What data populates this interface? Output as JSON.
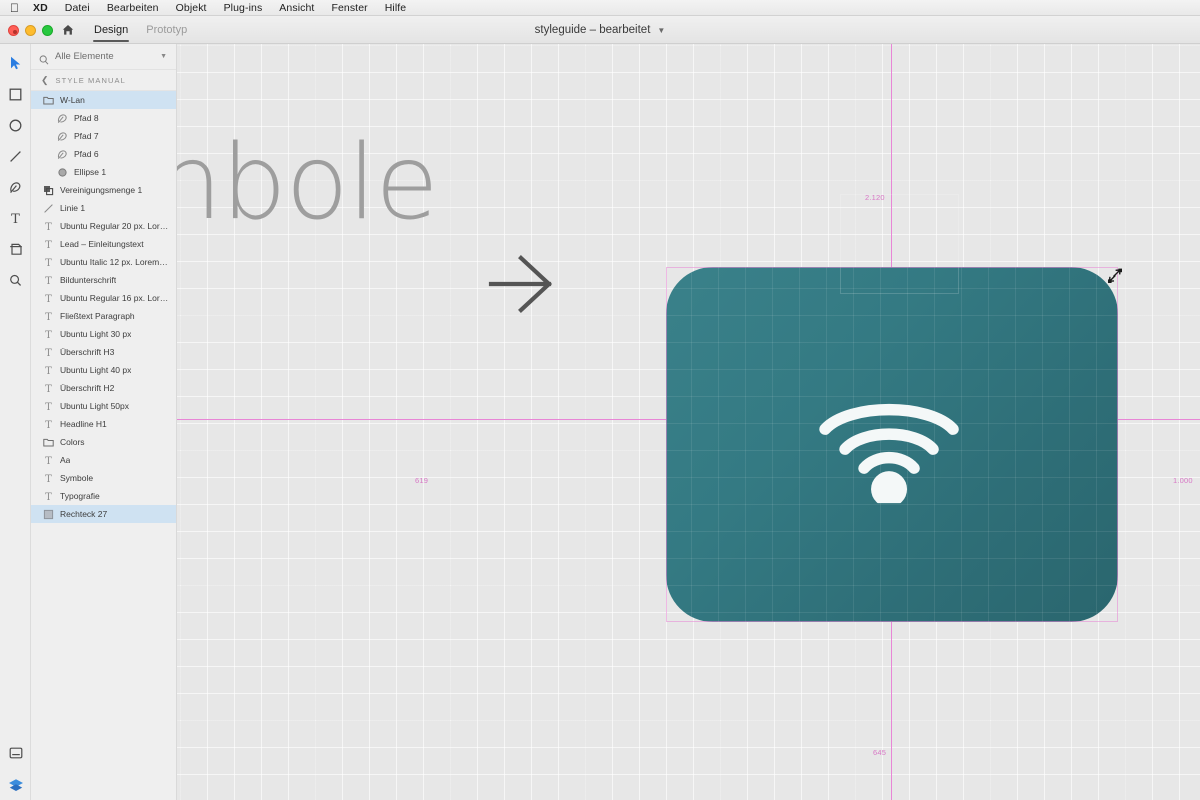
{
  "menubar": {
    "apple_icon": "apple-logo",
    "items": [
      {
        "label": "XD",
        "bold": true
      },
      {
        "label": "Datei",
        "bold": false
      },
      {
        "label": "Bearbeiten",
        "bold": false
      },
      {
        "label": "Objekt",
        "bold": false
      },
      {
        "label": "Plug-ins",
        "bold": false
      },
      {
        "label": "Ansicht",
        "bold": false
      },
      {
        "label": "Fenster",
        "bold": false
      },
      {
        "label": "Hilfe",
        "bold": false
      }
    ]
  },
  "titlebar": {
    "home_icon": "home-icon",
    "tabs": [
      {
        "label": "Design",
        "active": true
      },
      {
        "label": "Prototyp",
        "active": false
      }
    ],
    "document_title": "styleguide – bearbeitet",
    "title_chevron": "chevron-down-icon"
  },
  "toolrail": {
    "tools": [
      {
        "name": "select-tool",
        "icon": "cursor-arrow-icon",
        "active": true
      },
      {
        "name": "rectangle-tool",
        "icon": "square-icon",
        "active": false
      },
      {
        "name": "ellipse-tool",
        "icon": "circle-icon",
        "active": false
      },
      {
        "name": "line-tool",
        "icon": "line-icon",
        "active": false
      },
      {
        "name": "pen-tool",
        "icon": "pen-icon",
        "active": false
      },
      {
        "name": "text-tool",
        "icon": "text-T-icon",
        "active": false
      },
      {
        "name": "artboard-tool",
        "icon": "artboard-icon",
        "active": false
      },
      {
        "name": "zoom-tool",
        "icon": "magnifier-icon",
        "active": false
      }
    ],
    "bottom": [
      {
        "name": "panel-toggle",
        "icon": "panel-icon"
      },
      {
        "name": "creative-cloud-libraries",
        "icon": "layers-stack-icon"
      }
    ],
    "accent_color": "#2a7de1"
  },
  "sidebar": {
    "search": {
      "icon": "search-icon",
      "value": "Alle Elemente",
      "placeholder": "Alle Elemente",
      "chevron": "chevron-down-icon"
    },
    "group_header": {
      "back_icon": "chevron-left-icon",
      "title": "STYLE MANUAL"
    },
    "layers": [
      {
        "label": "W-Lan",
        "icon": "folder-icon",
        "indent": false,
        "selected": true
      },
      {
        "label": "Pfad 8",
        "icon": "path-icon",
        "indent": true,
        "selected": false
      },
      {
        "label": "Pfad 7",
        "icon": "path-icon",
        "indent": true,
        "selected": false
      },
      {
        "label": "Pfad 6",
        "icon": "path-icon",
        "indent": true,
        "selected": false
      },
      {
        "label": "Ellipse 1",
        "icon": "ellipse-icon",
        "indent": true,
        "selected": false
      },
      {
        "label": "Vereinigungsmenge 1",
        "icon": "boolean-union-icon",
        "indent": false,
        "selected": false
      },
      {
        "label": "Linie 1",
        "icon": "line-icon",
        "indent": false,
        "selected": false
      },
      {
        "label": "Ubuntu Regular 20 px. Lor…",
        "icon": "text-icon",
        "indent": false,
        "selected": false
      },
      {
        "label": "Lead – Einleitungstext",
        "icon": "text-icon",
        "indent": false,
        "selected": false
      },
      {
        "label": "Ubuntu Italic 12 px. Lorem…",
        "icon": "text-icon",
        "indent": false,
        "selected": false
      },
      {
        "label": "Bildunterschrift",
        "icon": "text-icon",
        "indent": false,
        "selected": false
      },
      {
        "label": "Ubuntu Regular 16 px. Lor…",
        "icon": "text-icon",
        "indent": false,
        "selected": false
      },
      {
        "label": "Fließtext Paragraph",
        "icon": "text-icon",
        "indent": false,
        "selected": false
      },
      {
        "label": "Ubuntu Light 30 px",
        "icon": "text-icon",
        "indent": false,
        "selected": false
      },
      {
        "label": "Überschrift H3",
        "icon": "text-icon",
        "indent": false,
        "selected": false
      },
      {
        "label": "Ubuntu Light 40 px",
        "icon": "text-icon",
        "indent": false,
        "selected": false
      },
      {
        "label": "Überschrift H2",
        "icon": "text-icon",
        "indent": false,
        "selected": false
      },
      {
        "label": "Ubuntu Light 50px",
        "icon": "text-icon",
        "indent": false,
        "selected": false
      },
      {
        "label": "Headline H1",
        "icon": "text-icon",
        "indent": false,
        "selected": false
      },
      {
        "label": "Colors",
        "icon": "folder-icon",
        "indent": false,
        "selected": false
      },
      {
        "label": "Aa",
        "icon": "text-icon",
        "indent": false,
        "selected": false
      },
      {
        "label": "Symbole",
        "icon": "text-icon",
        "indent": false,
        "selected": false
      },
      {
        "label": "Typografie",
        "icon": "text-icon",
        "indent": false,
        "selected": false
      },
      {
        "label": "Rechteck 27",
        "icon": "rectangle-icon",
        "indent": false,
        "selected": true
      }
    ],
    "selection_color": "#cfe2f2"
  },
  "canvas": {
    "background_text": "nbole",
    "guide_labels": [
      {
        "name": "guide-label-2120",
        "value": "2.120"
      },
      {
        "name": "guide-label-619",
        "value": "619"
      },
      {
        "name": "guide-label-1000",
        "value": "1.000"
      },
      {
        "name": "guide-label-645",
        "value": "645"
      }
    ],
    "guide_color": "#e886d6",
    "arrow_glyph": "arrow-right-glyph",
    "artboard_shape": {
      "name": "Rechteck 27",
      "icon": "wifi-icon",
      "gradient_from": "#3a818a",
      "gradient_to": "#2a666e",
      "corner_radius": 47
    },
    "cursor": "resize-diagonal-cursor"
  }
}
